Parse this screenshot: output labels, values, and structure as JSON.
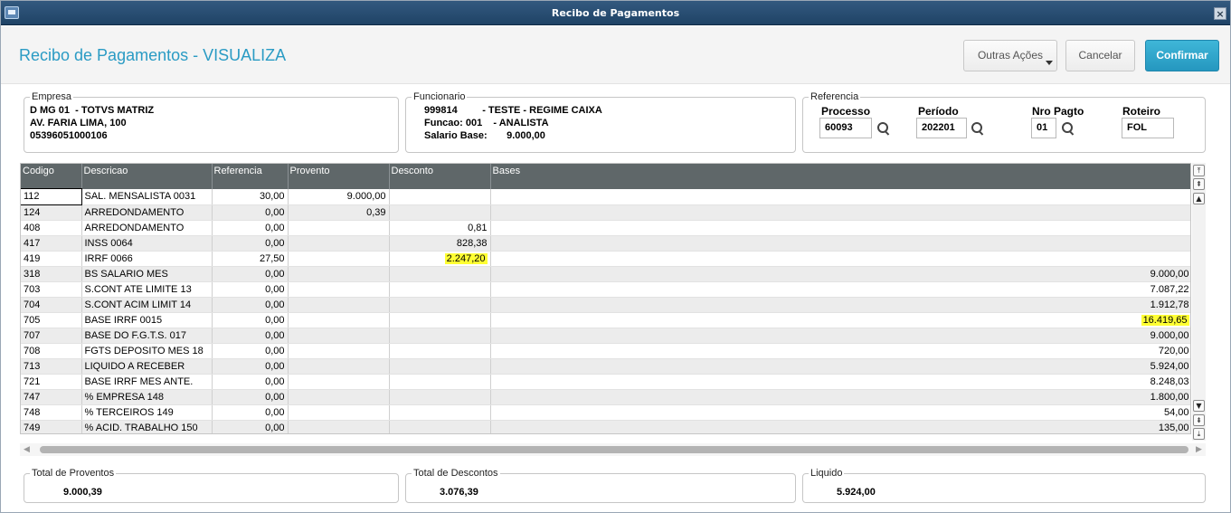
{
  "window": {
    "title": "Recibo de Pagamentos"
  },
  "header": {
    "page_title": "Recibo de Pagamentos - VISUALIZA",
    "btn_outras": "Outras Ações",
    "btn_cancel": "Cancelar",
    "btn_confirm": "Confirmar"
  },
  "empresa": {
    "legend": "Empresa",
    "line1": "D MG 01  - TOTVS MATRIZ",
    "line2": "AV. FARIA LIMA, 100",
    "line3": "05396051000106"
  },
  "funcionario": {
    "legend": "Funcionario",
    "line1": "999814         - TESTE - REGIME CAIXA",
    "line2": "Funcao: 001    - ANALISTA",
    "line3": "Salario Base:       9.000,00"
  },
  "referencia": {
    "legend": "Referencia",
    "processo_label": "Processo",
    "processo_value": "60093",
    "periodo_label": "Período",
    "periodo_value": "202201",
    "nro_label": "Nro Pagto",
    "nro_value": "01",
    "roteiro_label": "Roteiro",
    "roteiro_value": "FOL"
  },
  "grid": {
    "columns": [
      "Codigo",
      "Descricao",
      "Referencia",
      "Provento",
      "Desconto",
      "Bases"
    ],
    "rows": [
      {
        "codigo": "112",
        "descricao": "SAL. MENSALISTA 0031",
        "referencia": "30,00",
        "provento": "9.000,00",
        "desconto": "",
        "bases": ""
      },
      {
        "codigo": "124",
        "descricao": "ARREDONDAMENTO",
        "referencia": "0,00",
        "provento": "0,39",
        "desconto": "",
        "bases": ""
      },
      {
        "codigo": "408",
        "descricao": "ARREDONDAMENTO",
        "referencia": "0,00",
        "provento": "",
        "desconto": "0,81",
        "bases": ""
      },
      {
        "codigo": "417",
        "descricao": "INSS 0064",
        "referencia": "0,00",
        "provento": "",
        "desconto": "828,38",
        "bases": ""
      },
      {
        "codigo": "419",
        "descricao": "IRRF 0066",
        "referencia": "27,50",
        "provento": "",
        "desconto": "2.247,20",
        "bases": ""
      },
      {
        "codigo": "318",
        "descricao": "BS SALARIO MES",
        "referencia": "0,00",
        "provento": "",
        "desconto": "",
        "bases": "9.000,00"
      },
      {
        "codigo": "703",
        "descricao": "S.CONT ATE LIMITE 13",
        "referencia": "0,00",
        "provento": "",
        "desconto": "",
        "bases": "7.087,22"
      },
      {
        "codigo": "704",
        "descricao": "S.CONT ACIM LIMIT 14",
        "referencia": "0,00",
        "provento": "",
        "desconto": "",
        "bases": "1.912,78"
      },
      {
        "codigo": "705",
        "descricao": "BASE IRRF 0015",
        "referencia": "0,00",
        "provento": "",
        "desconto": "",
        "bases": "16.419,65"
      },
      {
        "codigo": "707",
        "descricao": "BASE DO F.G.T.S. 017",
        "referencia": "0,00",
        "provento": "",
        "desconto": "",
        "bases": "9.000,00"
      },
      {
        "codigo": "708",
        "descricao": "FGTS DEPOSITO MES 18",
        "referencia": "0,00",
        "provento": "",
        "desconto": "",
        "bases": "720,00"
      },
      {
        "codigo": "713",
        "descricao": "LIQUIDO A RECEBER",
        "referencia": "0,00",
        "provento": "",
        "desconto": "",
        "bases": "5.924,00"
      },
      {
        "codigo": "721",
        "descricao": "BASE IRRF MES ANTE.",
        "referencia": "0,00",
        "provento": "",
        "desconto": "",
        "bases": "8.248,03"
      },
      {
        "codigo": "747",
        "descricao": "% EMPRESA  148",
        "referencia": "0,00",
        "provento": "",
        "desconto": "",
        "bases": "1.800,00"
      },
      {
        "codigo": "748",
        "descricao": "% TERCEIROS 149",
        "referencia": "0,00",
        "provento": "",
        "desconto": "",
        "bases": "54,00"
      },
      {
        "codigo": "749",
        "descricao": "% ACID. TRABALHO 150",
        "referencia": "0,00",
        "provento": "",
        "desconto": "",
        "bases": "135,00"
      }
    ]
  },
  "totais": {
    "proventos_label": "Total de Proventos",
    "proventos_value": "9.000,39",
    "descontos_label": "Total de Descontos",
    "descontos_value": "3.076,39",
    "liquido_label": "Liquido",
    "liquido_value": "5.924,00"
  },
  "colors": {
    "title_bar": "#1f4366",
    "accent": "#2a9bc4",
    "highlight": "#ffff33"
  }
}
